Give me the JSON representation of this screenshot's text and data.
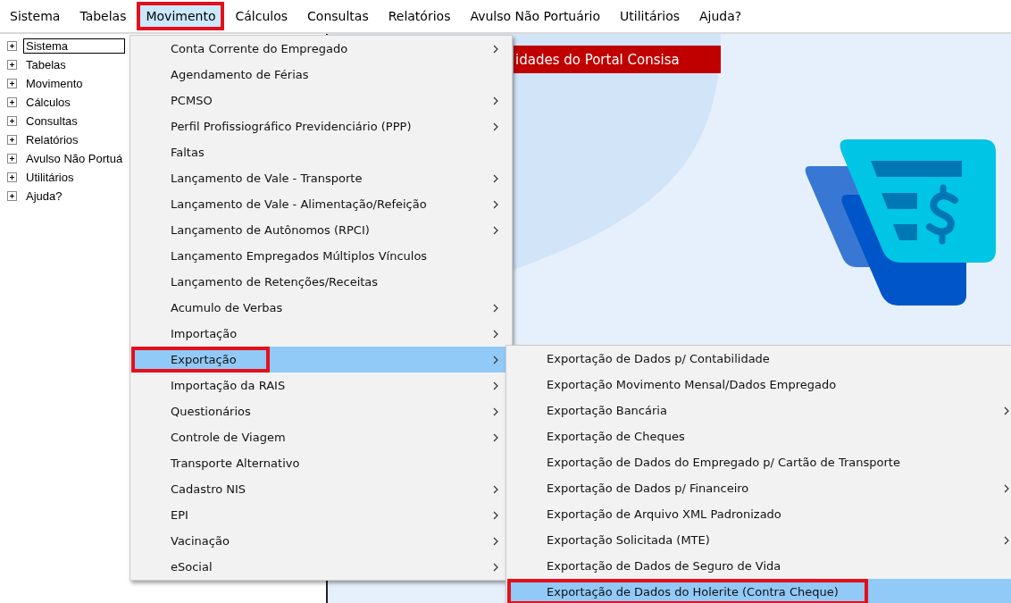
{
  "menu_bar": [
    {
      "label": "Sistema",
      "selected": false,
      "annotated": false
    },
    {
      "label": "Tabelas",
      "selected": false,
      "annotated": false
    },
    {
      "label": "Movimento",
      "selected": true,
      "annotated": true
    },
    {
      "label": "Cálculos",
      "selected": false,
      "annotated": false
    },
    {
      "label": "Consultas",
      "selected": false,
      "annotated": false
    },
    {
      "label": "Relatórios",
      "selected": false,
      "annotated": false
    },
    {
      "label": "Avulso Não Portuário",
      "selected": false,
      "annotated": false
    },
    {
      "label": "Utilitários",
      "selected": false,
      "annotated": false
    },
    {
      "label": "Ajuda?",
      "selected": false,
      "annotated": false
    }
  ],
  "tree": {
    "items": [
      {
        "label": "Sistema",
        "expanded": false,
        "focused": true
      },
      {
        "label": "Tabelas",
        "expanded": false,
        "focused": false
      },
      {
        "label": "Movimento",
        "expanded": false,
        "focused": false
      },
      {
        "label": "Cálculos",
        "expanded": false,
        "focused": false
      },
      {
        "label": "Consultas",
        "expanded": false,
        "focused": false
      },
      {
        "label": "Relatórios",
        "expanded": false,
        "focused": false
      },
      {
        "label": "Avulso Não Portuá",
        "expanded": false,
        "focused": false
      },
      {
        "label": "Utilitários",
        "expanded": false,
        "focused": false
      },
      {
        "label": "Ajuda?",
        "expanded": false,
        "focused": false
      }
    ]
  },
  "content": {
    "banner": "idades do Portal Consisa"
  },
  "menu": {
    "items": [
      {
        "label": "Conta Corrente do Empregado",
        "submenu": true,
        "selected": false,
        "annotated": false
      },
      {
        "label": "Agendamento de Férias",
        "submenu": false,
        "selected": false,
        "annotated": false
      },
      {
        "label": "PCMSO",
        "submenu": true,
        "selected": false,
        "annotated": false
      },
      {
        "label": "Perfil Profissiográfico Previdenciário (PPP)",
        "submenu": true,
        "selected": false,
        "annotated": false
      },
      {
        "label": "Faltas",
        "submenu": false,
        "selected": false,
        "annotated": false
      },
      {
        "label": "Lançamento de Vale - Transporte",
        "submenu": true,
        "selected": false,
        "annotated": false
      },
      {
        "label": "Lançamento de Vale - Alimentação/Refeição",
        "submenu": true,
        "selected": false,
        "annotated": false
      },
      {
        "label": "Lançamento de Autônomos (RPCI)",
        "submenu": true,
        "selected": false,
        "annotated": false
      },
      {
        "label": "Lançamento Empregados Múltiplos Vínculos",
        "submenu": false,
        "selected": false,
        "annotated": false
      },
      {
        "label": "Lançamento de Retenções/Receitas",
        "submenu": false,
        "selected": false,
        "annotated": false
      },
      {
        "label": "Acumulo de Verbas",
        "submenu": true,
        "selected": false,
        "annotated": false
      },
      {
        "label": "Importação",
        "submenu": true,
        "selected": false,
        "annotated": false
      },
      {
        "label": "Exportação",
        "submenu": true,
        "selected": true,
        "annotated": true
      },
      {
        "label": "Importação da RAIS",
        "submenu": true,
        "selected": false,
        "annotated": false
      },
      {
        "label": "Questionários",
        "submenu": true,
        "selected": false,
        "annotated": false
      },
      {
        "label": "Controle de Viagem",
        "submenu": true,
        "selected": false,
        "annotated": false
      },
      {
        "label": "Transporte Alternativo",
        "submenu": false,
        "selected": false,
        "annotated": false
      },
      {
        "label": "Cadastro NIS",
        "submenu": true,
        "selected": false,
        "annotated": false
      },
      {
        "label": "EPI",
        "submenu": true,
        "selected": false,
        "annotated": false
      },
      {
        "label": "Vacinação",
        "submenu": true,
        "selected": false,
        "annotated": false
      },
      {
        "label": "eSocial",
        "submenu": true,
        "selected": false,
        "annotated": false
      }
    ]
  },
  "submenu": {
    "items": [
      {
        "label": "Exportação de Dados p/ Contabilidade",
        "submenu": false,
        "selected": false,
        "annotated": false
      },
      {
        "label": "Exportação Movimento Mensal/Dados Empregado",
        "submenu": false,
        "selected": false,
        "annotated": false
      },
      {
        "label": "Exportação Bancária",
        "submenu": true,
        "selected": false,
        "annotated": false
      },
      {
        "label": "Exportação de Cheques",
        "submenu": false,
        "selected": false,
        "annotated": false
      },
      {
        "label": "Exportação de Dados do Empregado p/ Cartão de Transporte",
        "submenu": false,
        "selected": false,
        "annotated": false
      },
      {
        "label": "Exportação de Dados p/ Financeiro",
        "submenu": true,
        "selected": false,
        "annotated": false
      },
      {
        "label": "Exportação de Arquivo XML Padronizado",
        "submenu": false,
        "selected": false,
        "annotated": false
      },
      {
        "label": "Exportação Solicitada (MTE)",
        "submenu": true,
        "selected": false,
        "annotated": false
      },
      {
        "label": "Exportação de Dados de Seguro de Vida",
        "submenu": false,
        "selected": false,
        "annotated": false
      },
      {
        "label": "Exportação de Dados do Holerite (Contra Cheque)",
        "submenu": false,
        "selected": true,
        "annotated": true
      }
    ]
  }
}
